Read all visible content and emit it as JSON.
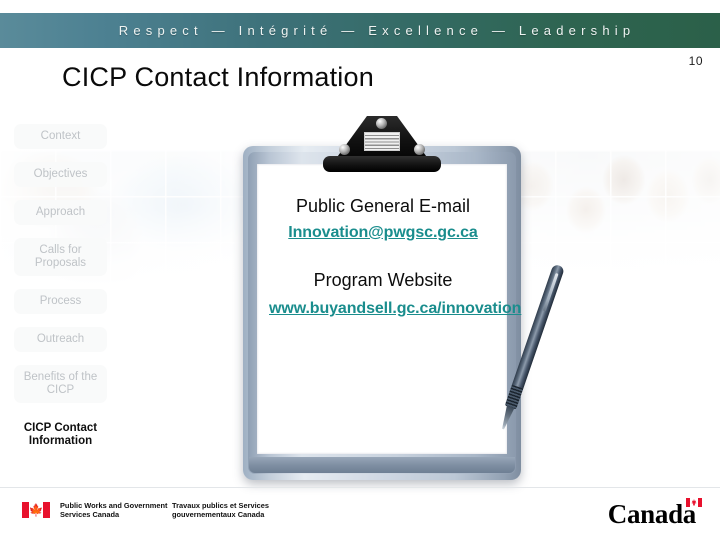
{
  "banner": {
    "values_text": "Respect   —   Intégrité   —   Excellence   —   Leadership"
  },
  "header": {
    "page_number": "10",
    "title": "CICP Contact Information"
  },
  "sidebar": {
    "items": [
      {
        "label": "Context",
        "active": false
      },
      {
        "label": "Objectives",
        "active": false
      },
      {
        "label": "Approach",
        "active": false
      },
      {
        "label": "Calls for Proposals",
        "active": false
      },
      {
        "label": "Process",
        "active": false
      },
      {
        "label": "Outreach",
        "active": false
      },
      {
        "label": "Benefits of the CICP",
        "active": false
      },
      {
        "label": "CICP Contact Information",
        "active": true
      }
    ]
  },
  "main": {
    "email_heading": "Public General E-mail",
    "email_link": "Innovation@pwgsc.gc.ca",
    "website_heading": "Program Website",
    "website_link": "www.buyandsell.gc.ca/innovation"
  },
  "footer": {
    "department_en": "Public Works and Government Services Canada",
    "department_fr": "Travaux publics et Services gouvernementaux Canada",
    "wordmark": "Canada"
  },
  "colors": {
    "banner_left": "#5a8b9a",
    "banner_right": "#2b6049",
    "link_teal": "#1a8d8d",
    "flag_red": "#e8112d",
    "title_black": "#0a0a0a",
    "nav_inactive": "#bfc3c7"
  }
}
